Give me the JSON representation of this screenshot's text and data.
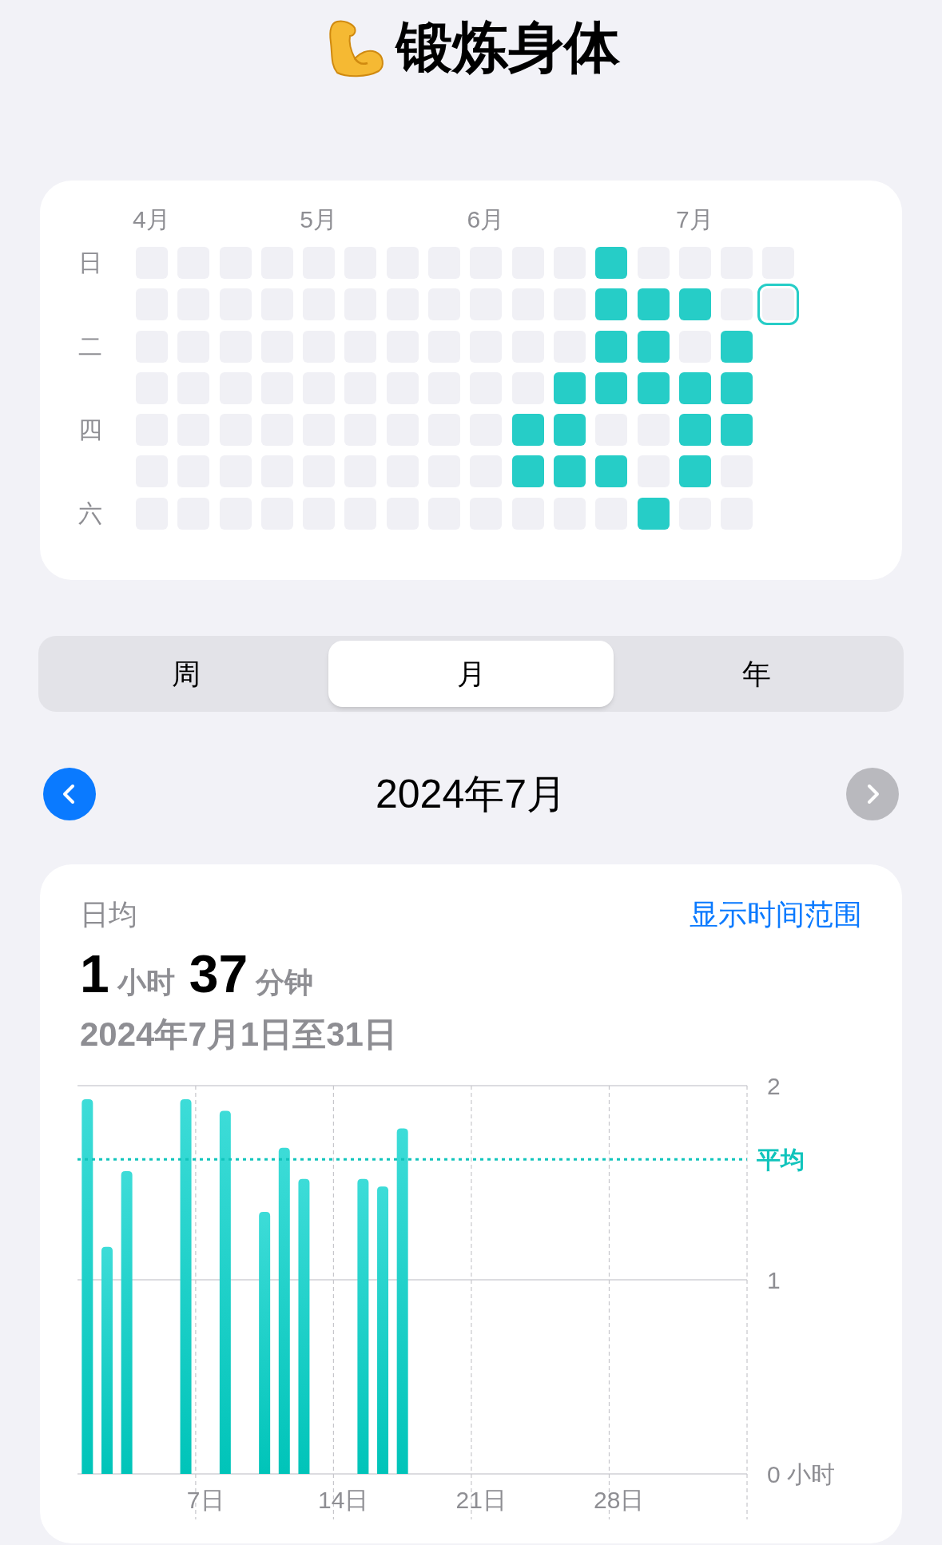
{
  "title": "锻炼身体",
  "heatmap": {
    "weeks": [
      {
        "month": "4月",
        "days": [
          {
            "weekday": "日",
            "active": false,
            "today": false
          },
          {
            "active": false,
            "today": false
          },
          {
            "weekday": "二",
            "active": false,
            "today": false
          },
          {
            "active": false,
            "today": false
          },
          {
            "weekday": "四",
            "active": false,
            "today": false
          },
          {
            "active": false,
            "today": false
          },
          {
            "weekday": "六",
            "active": false,
            "today": false
          }
        ]
      },
      {
        "days": [
          {
            "active": false,
            "today": false
          },
          {
            "active": false,
            "today": false
          },
          {
            "active": false,
            "today": false
          },
          {
            "active": false,
            "today": false
          },
          {
            "active": false,
            "today": false
          },
          {
            "active": false,
            "today": false
          },
          {
            "active": false,
            "today": false
          }
        ]
      },
      {
        "days": [
          {
            "active": false,
            "today": false
          },
          {
            "active": false,
            "today": false
          },
          {
            "active": false,
            "today": false
          },
          {
            "active": false,
            "today": false
          },
          {
            "active": false,
            "today": false
          },
          {
            "active": false,
            "today": false
          },
          {
            "active": false,
            "today": false
          }
        ]
      },
      {
        "days": [
          {
            "active": false,
            "today": false
          },
          {
            "active": false,
            "today": false
          },
          {
            "active": false,
            "today": false
          },
          {
            "active": false,
            "today": false
          },
          {
            "active": false,
            "today": false
          },
          {
            "active": false,
            "today": false
          },
          {
            "active": false,
            "today": false
          }
        ]
      },
      {
        "month": "5月",
        "days": [
          {
            "active": false,
            "today": false
          },
          {
            "active": false,
            "today": false
          },
          {
            "active": false,
            "today": false
          },
          {
            "active": false,
            "today": false
          },
          {
            "active": false,
            "today": false
          },
          {
            "active": false,
            "today": false
          },
          {
            "active": false,
            "today": false
          }
        ]
      },
      {
        "days": [
          {
            "active": false,
            "today": false
          },
          {
            "active": false,
            "today": false
          },
          {
            "active": false,
            "today": false
          },
          {
            "active": false,
            "today": false
          },
          {
            "active": false,
            "today": false
          },
          {
            "active": false,
            "today": false
          },
          {
            "active": false,
            "today": false
          }
        ]
      },
      {
        "days": [
          {
            "active": false,
            "today": false
          },
          {
            "active": false,
            "today": false
          },
          {
            "active": false,
            "today": false
          },
          {
            "active": false,
            "today": false
          },
          {
            "active": false,
            "today": false
          },
          {
            "active": false,
            "today": false
          },
          {
            "active": false,
            "today": false
          }
        ]
      },
      {
        "days": [
          {
            "active": false,
            "today": false
          },
          {
            "active": false,
            "today": false
          },
          {
            "active": false,
            "today": false
          },
          {
            "active": false,
            "today": false
          },
          {
            "active": false,
            "today": false
          },
          {
            "active": false,
            "today": false
          },
          {
            "active": false,
            "today": false
          }
        ]
      },
      {
        "month": "6月",
        "days": [
          {
            "active": false,
            "today": false
          },
          {
            "active": false,
            "today": false
          },
          {
            "active": false,
            "today": false
          },
          {
            "active": false,
            "today": false
          },
          {
            "active": false,
            "today": false
          },
          {
            "active": false,
            "today": false
          },
          {
            "active": false,
            "today": false
          }
        ]
      },
      {
        "days": [
          {
            "active": false,
            "today": false
          },
          {
            "active": false,
            "today": false
          },
          {
            "active": false,
            "today": false
          },
          {
            "active": false,
            "today": false
          },
          {
            "active": true,
            "today": false
          },
          {
            "active": true,
            "today": false
          },
          {
            "active": false,
            "today": false
          }
        ]
      },
      {
        "days": [
          {
            "active": false,
            "today": false
          },
          {
            "active": false,
            "today": false
          },
          {
            "active": false,
            "today": false
          },
          {
            "active": true,
            "today": false
          },
          {
            "active": true,
            "today": false
          },
          {
            "active": true,
            "today": false
          },
          {
            "active": false,
            "today": false
          }
        ]
      },
      {
        "days": [
          {
            "active": true,
            "today": false
          },
          {
            "active": true,
            "today": false
          },
          {
            "active": true,
            "today": false
          },
          {
            "active": true,
            "today": false
          },
          {
            "active": false,
            "today": false
          },
          {
            "active": true,
            "today": false
          },
          {
            "active": false,
            "today": false
          }
        ]
      },
      {
        "days": [
          {
            "active": false,
            "today": false
          },
          {
            "active": true,
            "today": false
          },
          {
            "active": true,
            "today": false
          },
          {
            "active": true,
            "today": false
          },
          {
            "active": false,
            "today": false
          },
          {
            "active": false,
            "today": false
          },
          {
            "active": true,
            "today": false
          }
        ]
      },
      {
        "month": "7月",
        "days": [
          {
            "active": false,
            "today": false
          },
          {
            "active": true,
            "today": false
          },
          {
            "active": false,
            "today": false
          },
          {
            "active": true,
            "today": false
          },
          {
            "active": true,
            "today": false
          },
          {
            "active": true,
            "today": false
          },
          {
            "active": false,
            "today": false
          }
        ]
      },
      {
        "days": [
          {
            "active": false,
            "today": false
          },
          {
            "active": false,
            "today": false
          },
          {
            "active": true,
            "today": false
          },
          {
            "active": true,
            "today": false
          },
          {
            "active": true,
            "today": false
          },
          {
            "active": false,
            "today": false
          },
          {
            "active": false,
            "today": false
          }
        ]
      },
      {
        "days": [
          {
            "active": false,
            "today": false
          },
          {
            "active": false,
            "today": true
          }
        ]
      }
    ]
  },
  "segments": [
    {
      "label": "周",
      "selected": false
    },
    {
      "label": "月",
      "selected": true
    },
    {
      "label": "年",
      "selected": false
    }
  ],
  "period": {
    "title": "2024年7月",
    "prev_disabled": false,
    "next_disabled": true
  },
  "summary": {
    "label": "日均",
    "link": "显示时间范围",
    "value_parts": [
      {
        "text": "1",
        "kind": "number"
      },
      {
        "text": "小时",
        "kind": "unit"
      },
      {
        "text": "37",
        "kind": "number"
      },
      {
        "text": "分钟",
        "kind": "unit"
      }
    ],
    "range": "2024年7月1日至31日",
    "chart_data": {
      "type": "bar",
      "x": [
        1,
        2,
        3,
        6,
        8,
        10,
        11,
        12,
        15,
        16,
        17
      ],
      "series": [
        {
          "color": "#1fd0c8",
          "values": [
            1.93,
            1.17,
            1.56,
            1.93,
            1.87,
            1.35,
            1.68,
            1.52,
            1.52,
            1.48,
            1.78
          ]
        }
      ],
      "xlim": [
        0.5,
        34.5
      ],
      "ylim": [
        0,
        2
      ],
      "xticks": [
        {
          "value": 7,
          "label": "7日"
        },
        {
          "value": 14,
          "label": "14日"
        },
        {
          "value": 21,
          "label": "21日"
        },
        {
          "value": 28,
          "label": "28日"
        }
      ],
      "yticks": [
        {
          "value": 0,
          "label": "0 小时"
        },
        {
          "value": 1,
          "label": "1"
        },
        {
          "value": 2,
          "label": "2"
        }
      ],
      "ref_lines": [
        {
          "axis": "y",
          "value": 1.62,
          "label": "平均"
        }
      ]
    }
  }
}
